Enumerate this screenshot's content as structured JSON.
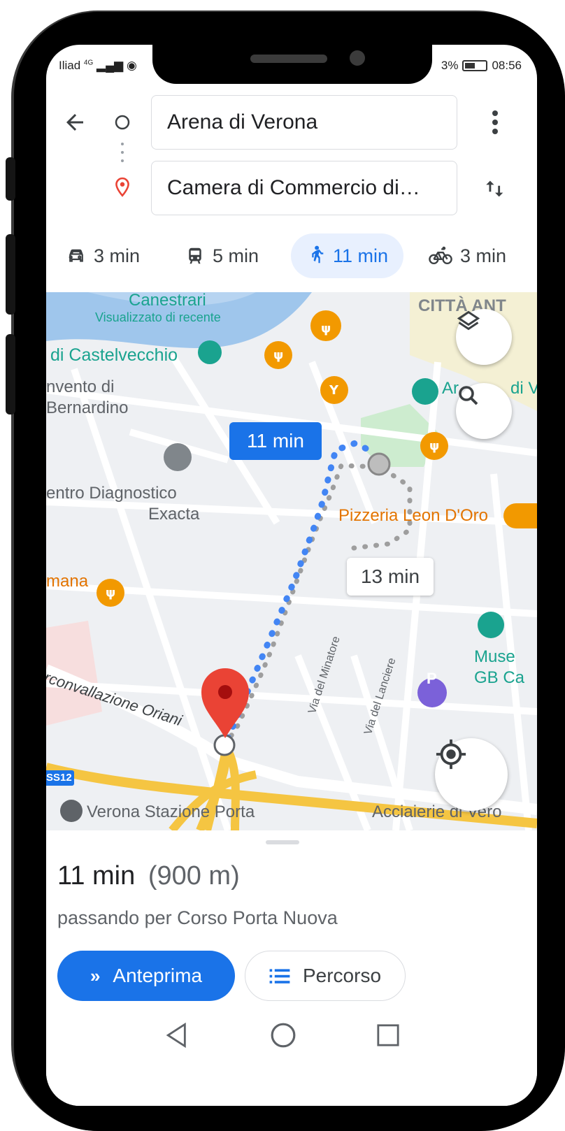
{
  "status_bar": {
    "carrier": "Iliad",
    "network": "4G",
    "battery": "3%",
    "time": "08:56"
  },
  "directions": {
    "origin": "Arena di Verona",
    "destination": "Camera di Commercio di…"
  },
  "modes": [
    {
      "icon": "car-icon",
      "label": "3 min"
    },
    {
      "icon": "transit-icon",
      "label": "5 min"
    },
    {
      "icon": "walk-icon",
      "label": "11 min",
      "active": true
    },
    {
      "icon": "bike-icon",
      "label": "3 min"
    }
  ],
  "map": {
    "labels": {
      "canestrari": "Canestrari",
      "recent": "Visualizzato di recente",
      "castelvecchio": "di Castelvecchio",
      "citta": "CITTÀ ANT",
      "convento1": "nvento di",
      "convento2": "Bernardino",
      "arena_ab": "Ar",
      "arena_di": "di V",
      "diagnostico1": "entro Diagnostico",
      "diagnostico2": "Exacta",
      "pizzeria": "Pizzeria Leon D'Oro",
      "mana": "mana",
      "minatore": "Via del Minatore",
      "lanciere": "Via del Lanciere",
      "musei1": "Muse",
      "musei2": "GB Ca",
      "circonv": "rconvallazione Oriani",
      "ss12": "SS12",
      "stazione": "Verona Stazione Porta",
      "acciaierie": "Acciaierie di Vero",
      "parking": "P"
    },
    "route_time_selected": "11 min",
    "route_time_alt": "13 min",
    "colors": {
      "route_walk": "#4285f4",
      "route_alt": "#9e9e9e",
      "water": "#9fc6ec",
      "park": "#cdeccf",
      "accent": "#1a73e8",
      "restaurant": "#f29900",
      "museum": "#1aa38f",
      "pin": "#ea4335"
    }
  },
  "summary": {
    "duration": "11 min",
    "distance": "(900 m)",
    "via": "passando per Corso Porta Nuova",
    "preview_label": "Anteprima",
    "steps_label": "Percorso"
  },
  "nav_bar": {
    "back": "back-icon",
    "home": "home-icon",
    "recents": "recents-icon"
  }
}
